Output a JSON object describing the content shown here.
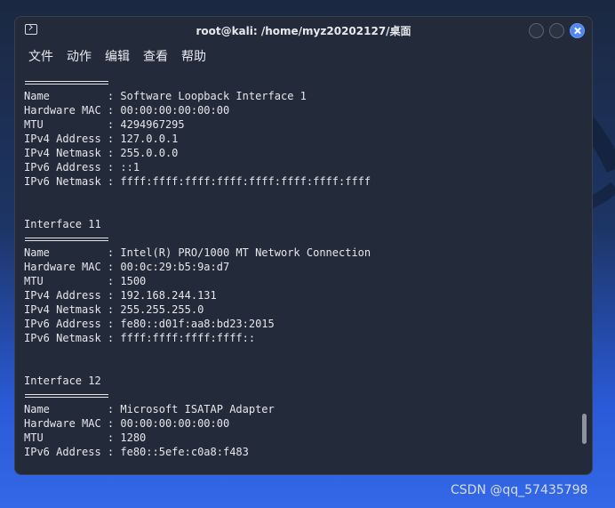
{
  "window": {
    "title": "root@kali: /home/myz20202127/桌面"
  },
  "menu": {
    "items": [
      "文件",
      "动作",
      "编辑",
      "查看",
      "帮助"
    ]
  },
  "terminal": {
    "lines": [
      {
        "type": "rule"
      },
      {
        "type": "text",
        "text": "Name         : Software Loopback Interface 1"
      },
      {
        "type": "text",
        "text": "Hardware MAC : 00:00:00:00:00:00"
      },
      {
        "type": "text",
        "text": "MTU          : 4294967295"
      },
      {
        "type": "text",
        "text": "IPv4 Address : 127.0.0.1"
      },
      {
        "type": "text",
        "text": "IPv4 Netmask : 255.0.0.0"
      },
      {
        "type": "text",
        "text": "IPv6 Address : ::1"
      },
      {
        "type": "text",
        "text": "IPv6 Netmask : ffff:ffff:ffff:ffff:ffff:ffff:ffff:ffff"
      },
      {
        "type": "blank"
      },
      {
        "type": "blank"
      },
      {
        "type": "text",
        "text": "Interface 11"
      },
      {
        "type": "rule"
      },
      {
        "type": "text",
        "text": "Name         : Intel(R) PRO/1000 MT Network Connection"
      },
      {
        "type": "text",
        "text": "Hardware MAC : 00:0c:29:b5:9a:d7"
      },
      {
        "type": "text",
        "text": "MTU          : 1500"
      },
      {
        "type": "text",
        "text": "IPv4 Address : 192.168.244.131"
      },
      {
        "type": "text",
        "text": "IPv4 Netmask : 255.255.255.0"
      },
      {
        "type": "text",
        "text": "IPv6 Address : fe80::d01f:aa8:bd23:2015"
      },
      {
        "type": "text",
        "text": "IPv6 Netmask : ffff:ffff:ffff:ffff::"
      },
      {
        "type": "blank"
      },
      {
        "type": "blank"
      },
      {
        "type": "text",
        "text": "Interface 12"
      },
      {
        "type": "rule"
      },
      {
        "type": "text",
        "text": "Name         : Microsoft ISATAP Adapter"
      },
      {
        "type": "text",
        "text": "Hardware MAC : 00:00:00:00:00:00"
      },
      {
        "type": "text",
        "text": "MTU          : 1280"
      },
      {
        "type": "text",
        "text": "IPv6 Address : fe80::5efe:c0a8:f483"
      }
    ]
  },
  "watermark": "CSDN @qq_57435798",
  "colors": {
    "terminal_bg": "#232a3a",
    "close_button": "#4f86f2",
    "text": "#e5e7eb"
  },
  "icons": {
    "terminal": "terminal-icon",
    "close": "close-icon"
  }
}
